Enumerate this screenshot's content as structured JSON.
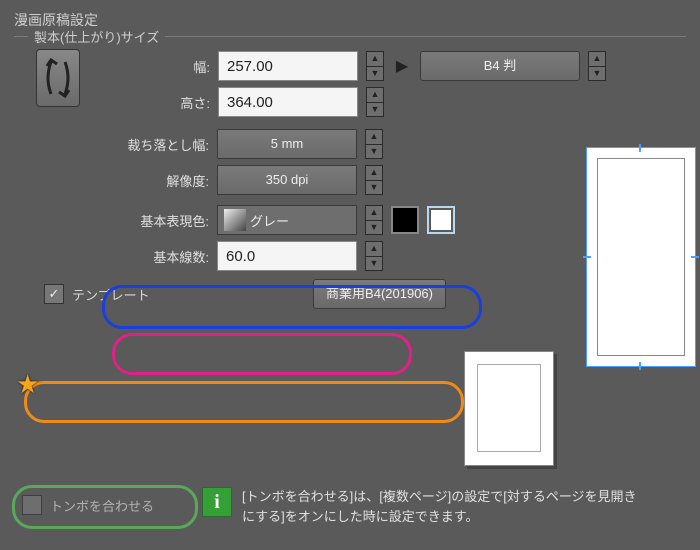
{
  "title": "漫画原稿設定",
  "section_binding": "製本(仕上がり)サイズ",
  "labels": {
    "width": "幅:",
    "height": "高さ:",
    "bleed": "裁ち落とし幅:",
    "resolution": "解像度:",
    "basic_color": "基本表現色:",
    "basic_lines": "基本線数:",
    "template": "テンプレート",
    "align_tombo": "トンボを合わせる"
  },
  "values": {
    "width": "257.00",
    "height": "364.00",
    "bleed": "5 mm",
    "resolution": "350 dpi",
    "basic_color": "グレー",
    "basic_lines": "60.0",
    "preset": "B4 判",
    "template": "商業用B4(201906)"
  },
  "checkboxes": {
    "template_checked": "✓",
    "tombo_checked": ""
  },
  "info_text": "[トンボを合わせる]は、[複数ページ]の設定で[対するページを見開きにする]をオンにした時に設定できます。"
}
